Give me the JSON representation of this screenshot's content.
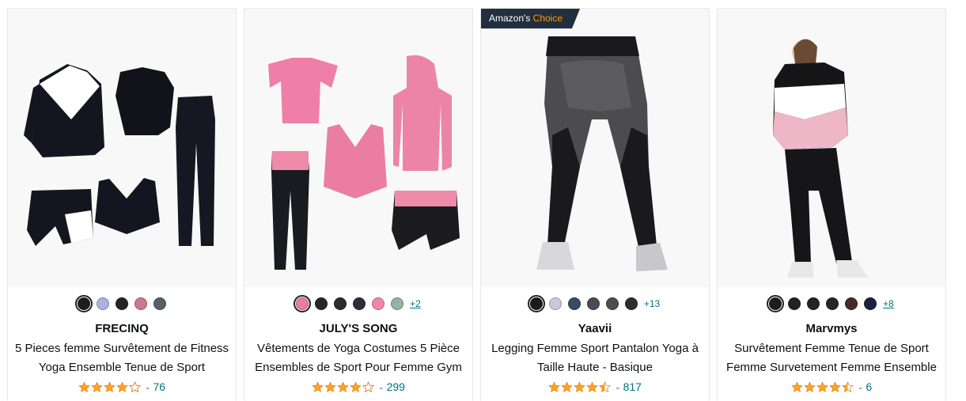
{
  "products": [
    {
      "brand": "FRECINQ",
      "title": "5 Pieces femme Survêtement de Fitness Yoga Ensemble Tenue de Sport",
      "rating": 4.0,
      "review_count": "76",
      "badge": null,
      "swatches": [
        "#1c1c24",
        "#a9b2e2",
        "#222428",
        "#c97a8a",
        "#56606a"
      ],
      "more_colors": ""
    },
    {
      "brand": "JULY'S SONG",
      "title": "Vêtements de Yoga Costumes 5 Pièce Ensembles de Sport Pour Femme Gym",
      "rating": 4.0,
      "review_count": "299",
      "badge": null,
      "swatches": [
        "#e97ea1",
        "#25272b",
        "#2b2d31",
        "#2a3039",
        "#ef86aa",
        "#94b4a2"
      ],
      "more_colors": "+2"
    },
    {
      "brand": "Yaavii",
      "title": "Legging Femme Sport Pantalon Yoga à Taille Haute - Basique",
      "rating": 4.5,
      "review_count": "817",
      "badge": {
        "prefix": "Amazon's",
        "accent": "Choice"
      },
      "swatches": [
        "#1b1b1d",
        "#c9c8dc",
        "#3a4a62",
        "#4b4b57",
        "#4e4e50",
        "#2e2e30"
      ],
      "more_colors": "+13"
    },
    {
      "brand": "Marvmys",
      "title": "Survêtement Femme Tenue de Sport Femme Survetement Femme Ensemble",
      "rating": 4.5,
      "review_count": "6",
      "badge": null,
      "swatches": [
        "#1d1d1f",
        "#222224",
        "#232325",
        "#262628",
        "#4a2a28",
        "#1d2140"
      ],
      "more_colors": "+8"
    }
  ],
  "colors": {
    "star": "#ffa41c",
    "link": "#007185",
    "badge_bg": "#232f3e",
    "badge_accent": "#ff9900"
  }
}
